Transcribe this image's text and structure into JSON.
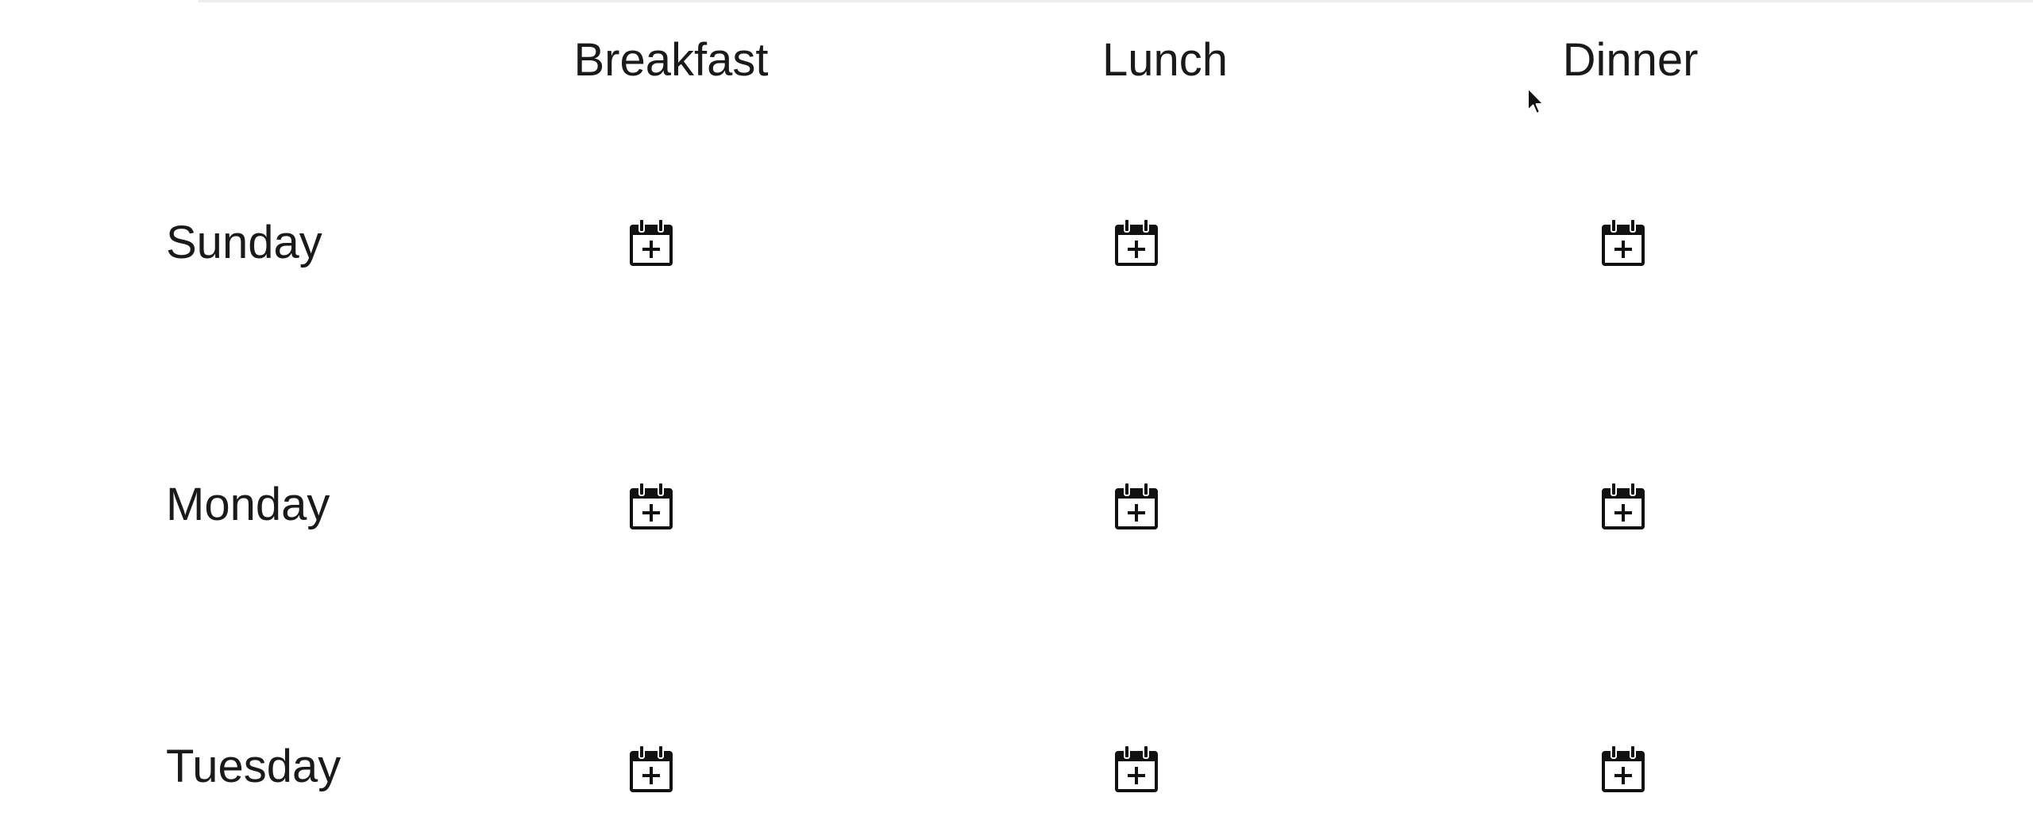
{
  "planner": {
    "meals": [
      "Breakfast",
      "Lunch",
      "Dinner"
    ],
    "days": [
      "Sunday",
      "Monday",
      "Tuesday"
    ]
  },
  "icons": {
    "add_meal": "calendar-plus-icon",
    "cursor": "mouse-pointer-icon"
  },
  "colors": {
    "text": "#1a1a1a",
    "icon": "#111111",
    "background": "#ffffff"
  }
}
